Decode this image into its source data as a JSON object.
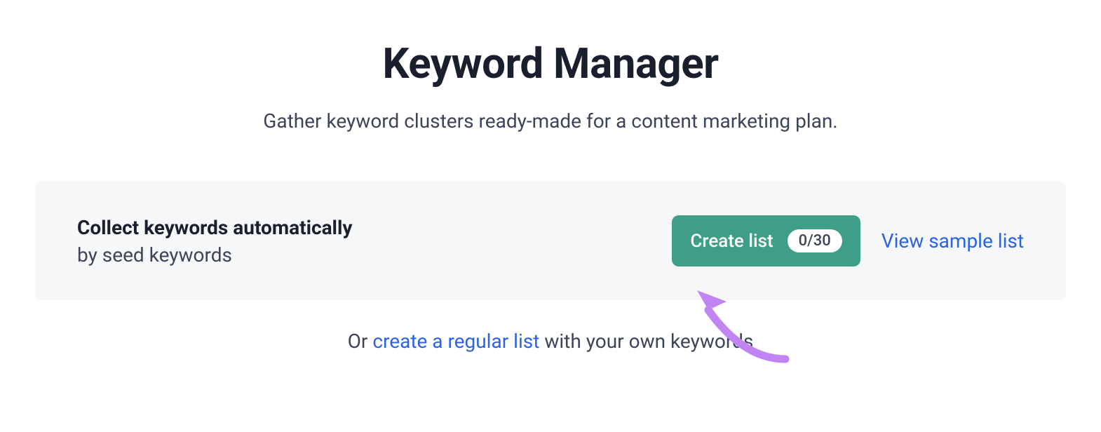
{
  "header": {
    "title": "Keyword Manager",
    "subtitle": "Gather keyword clusters ready-made for a content marketing plan."
  },
  "card": {
    "heading": "Collect keywords automatically",
    "sub": "by seed keywords",
    "button_label": "Create list",
    "badge": "0/30",
    "view_link": "View sample list"
  },
  "footer": {
    "prefix": "Or ",
    "link": "create a regular list",
    "suffix": " with your own keywords"
  }
}
